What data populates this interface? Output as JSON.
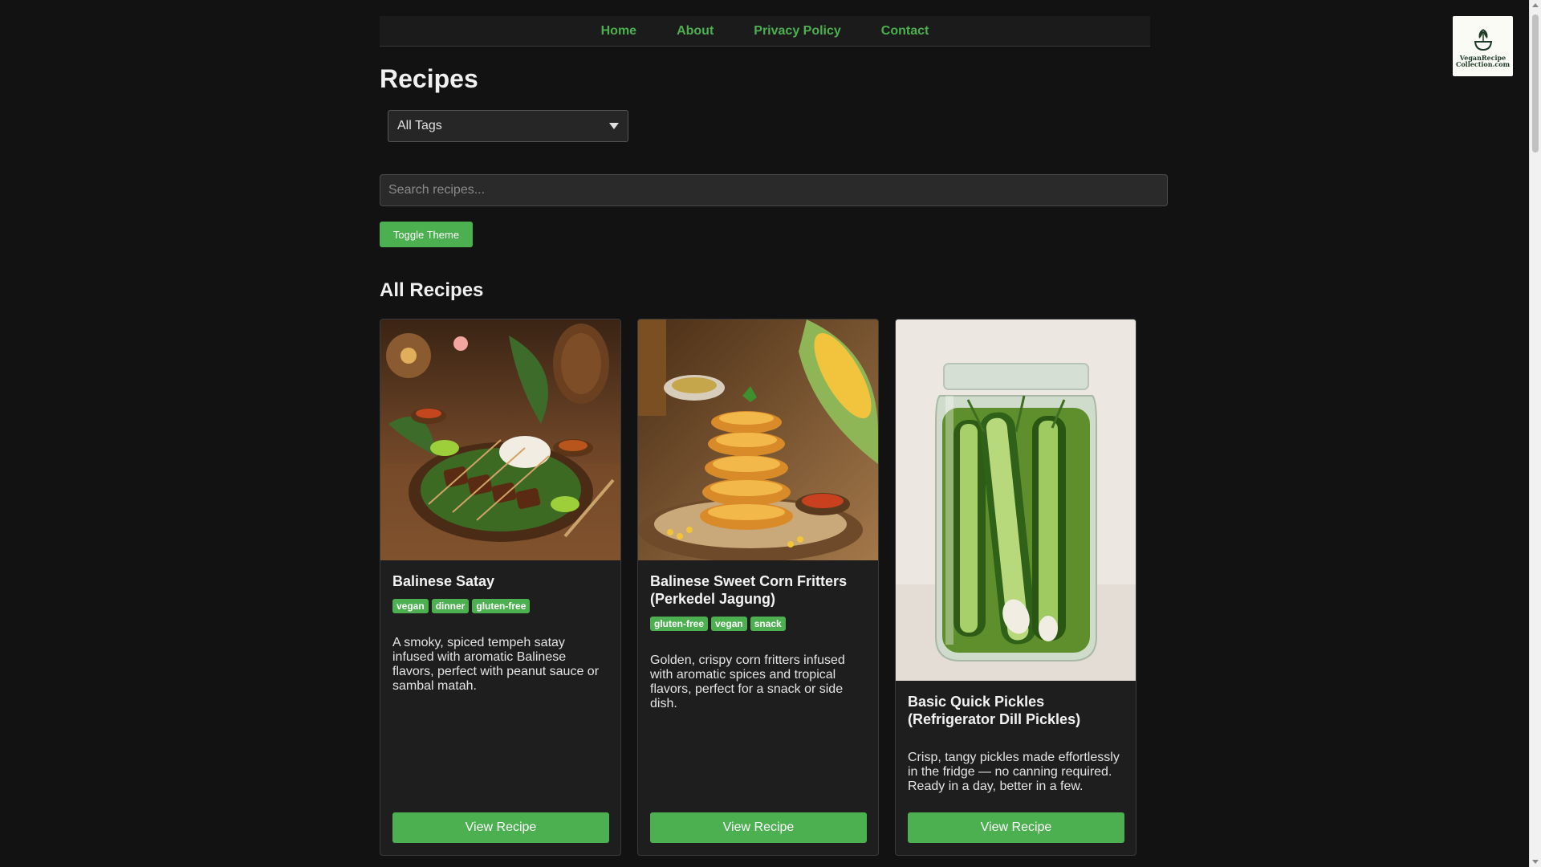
{
  "nav": {
    "items": [
      {
        "label": "Home"
      },
      {
        "label": "About"
      },
      {
        "label": "Privacy Policy"
      },
      {
        "label": "Contact"
      }
    ]
  },
  "logo": {
    "text": "VeganRecipe Collection.com",
    "icon": "plant-bowl-icon"
  },
  "page": {
    "title": "Recipes"
  },
  "filters": {
    "tag_select": {
      "selected": "All Tags"
    },
    "search": {
      "placeholder": "Search recipes...",
      "value": ""
    },
    "toggle_label": "Toggle Theme"
  },
  "section": {
    "title": "All Recipes"
  },
  "recipes": [
    {
      "title": "Balinese Satay",
      "tags": [
        "vegan",
        "dinner",
        "gluten-free"
      ],
      "description": "A smoky, spiced tempeh satay infused with aromatic Balinese flavors, perfect with peanut sauce or sambal matah.",
      "button": "View Recipe"
    },
    {
      "title": "Balinese Sweet Corn Fritters (Perkedel Jagung)",
      "tags": [
        "gluten-free",
        "vegan",
        "snack"
      ],
      "description": "Golden, crispy corn fritters infused with aromatic spices and tropical flavors, perfect for a snack or side dish.",
      "button": "View Recipe"
    },
    {
      "title": "Basic Quick Pickles (Refrigerator Dill Pickles)",
      "tags": [],
      "description": "Crisp, tangy pickles made effortlessly in the fridge — no canning required. Ready in a day, better in a few.",
      "button": "View Recipe"
    }
  ],
  "colors": {
    "accent": "#4caf50",
    "background": "#121212",
    "card": "#1e1e1e"
  }
}
